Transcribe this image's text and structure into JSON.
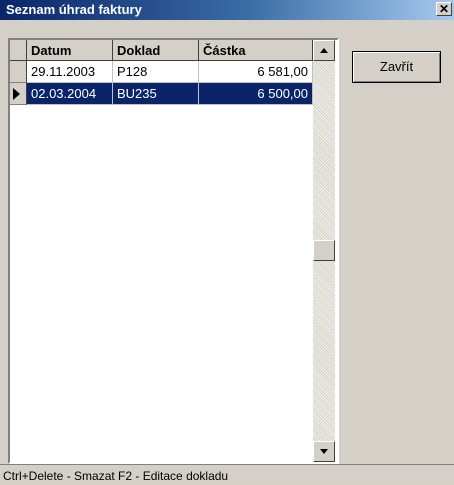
{
  "window": {
    "title": "Seznam úhrad faktury",
    "close_glyph": "✕"
  },
  "table": {
    "columns": [
      "Datum",
      "Doklad",
      "Částka"
    ],
    "rows": [
      {
        "date": "29.11.2003",
        "doc": "P128",
        "amount": "6 581,00",
        "selected": false
      },
      {
        "date": "02.03.2004",
        "doc": "BU235",
        "amount": "6 500,00",
        "selected": true
      }
    ]
  },
  "buttons": {
    "close": "Zavřít"
  },
  "status": {
    "text": "Ctrl+Delete - Smazat   F2 - Editace dokladu"
  }
}
